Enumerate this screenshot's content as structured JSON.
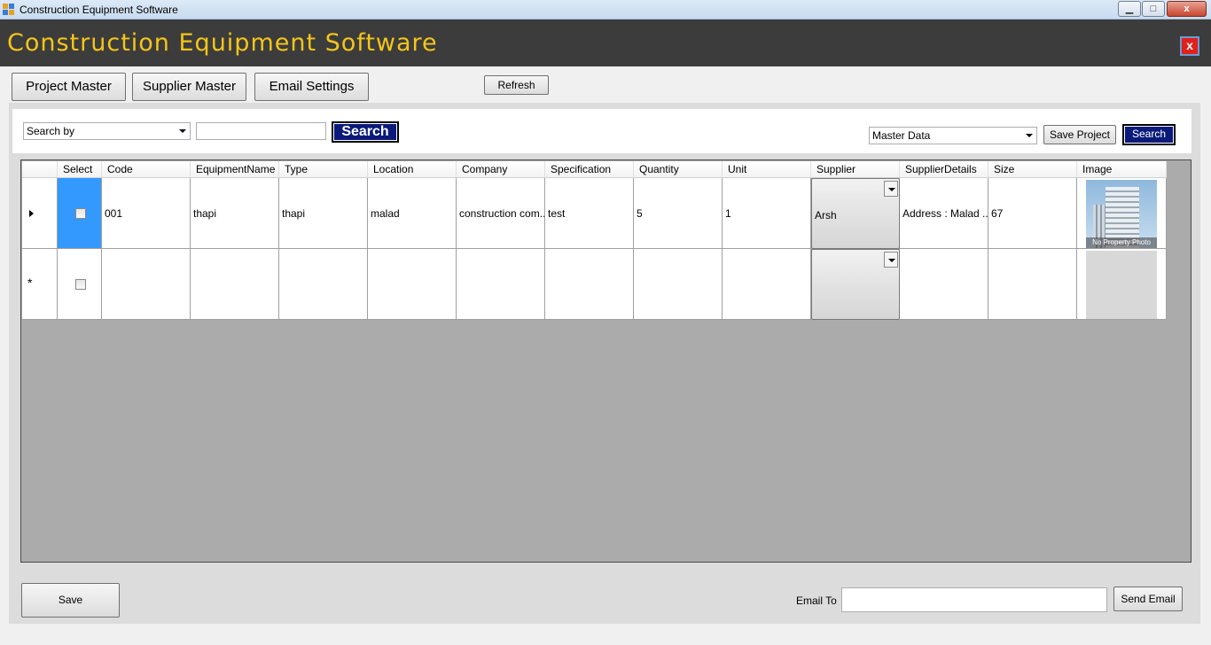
{
  "window": {
    "title": "Construction Equipment Software",
    "controls": {
      "minimize": "▁",
      "maximize": "□",
      "close": "x"
    }
  },
  "header": {
    "title": "Construction Equipment Software",
    "close_label": "x"
  },
  "tabs": [
    {
      "label": "Project Master"
    },
    {
      "label": "Supplier Master"
    },
    {
      "label": "Email Settings"
    }
  ],
  "toolbar": {
    "refresh_label": "Refresh"
  },
  "search": {
    "search_by_value": "Search by",
    "query_value": "",
    "search_label": "Search",
    "master_select_value": "Master Data",
    "save_project_label": "Save Project",
    "right_search_label": "Search"
  },
  "grid": {
    "columns": [
      "Select",
      "Code",
      "EquipmentName",
      "Type",
      "Location",
      "Company",
      "Specification",
      "Quantity",
      "Unit",
      "Supplier",
      "SupplierDetails",
      "Size",
      "Image"
    ],
    "rows": [
      {
        "selected": false,
        "code": "001",
        "equipment_name": "thapi",
        "type": "thapi",
        "location": "malad",
        "company": "construction com...",
        "specification": "test",
        "quantity": "5",
        "unit": "1",
        "supplier": "Arsh",
        "supplier_details": "Address : Malad ...",
        "size": "67",
        "image_caption": "No Property Photo"
      }
    ],
    "new_row_marker": "*"
  },
  "footer": {
    "save_label": "Save",
    "email_to_label": "Email To",
    "email_to_value": "",
    "send_email_label": "Send Email"
  },
  "colors": {
    "header_bg": "#3c3c3c",
    "header_title": "#f5c518",
    "navy_button": "#0a1a7a",
    "selection": "#3399ff",
    "grid_bg": "#ababab"
  }
}
